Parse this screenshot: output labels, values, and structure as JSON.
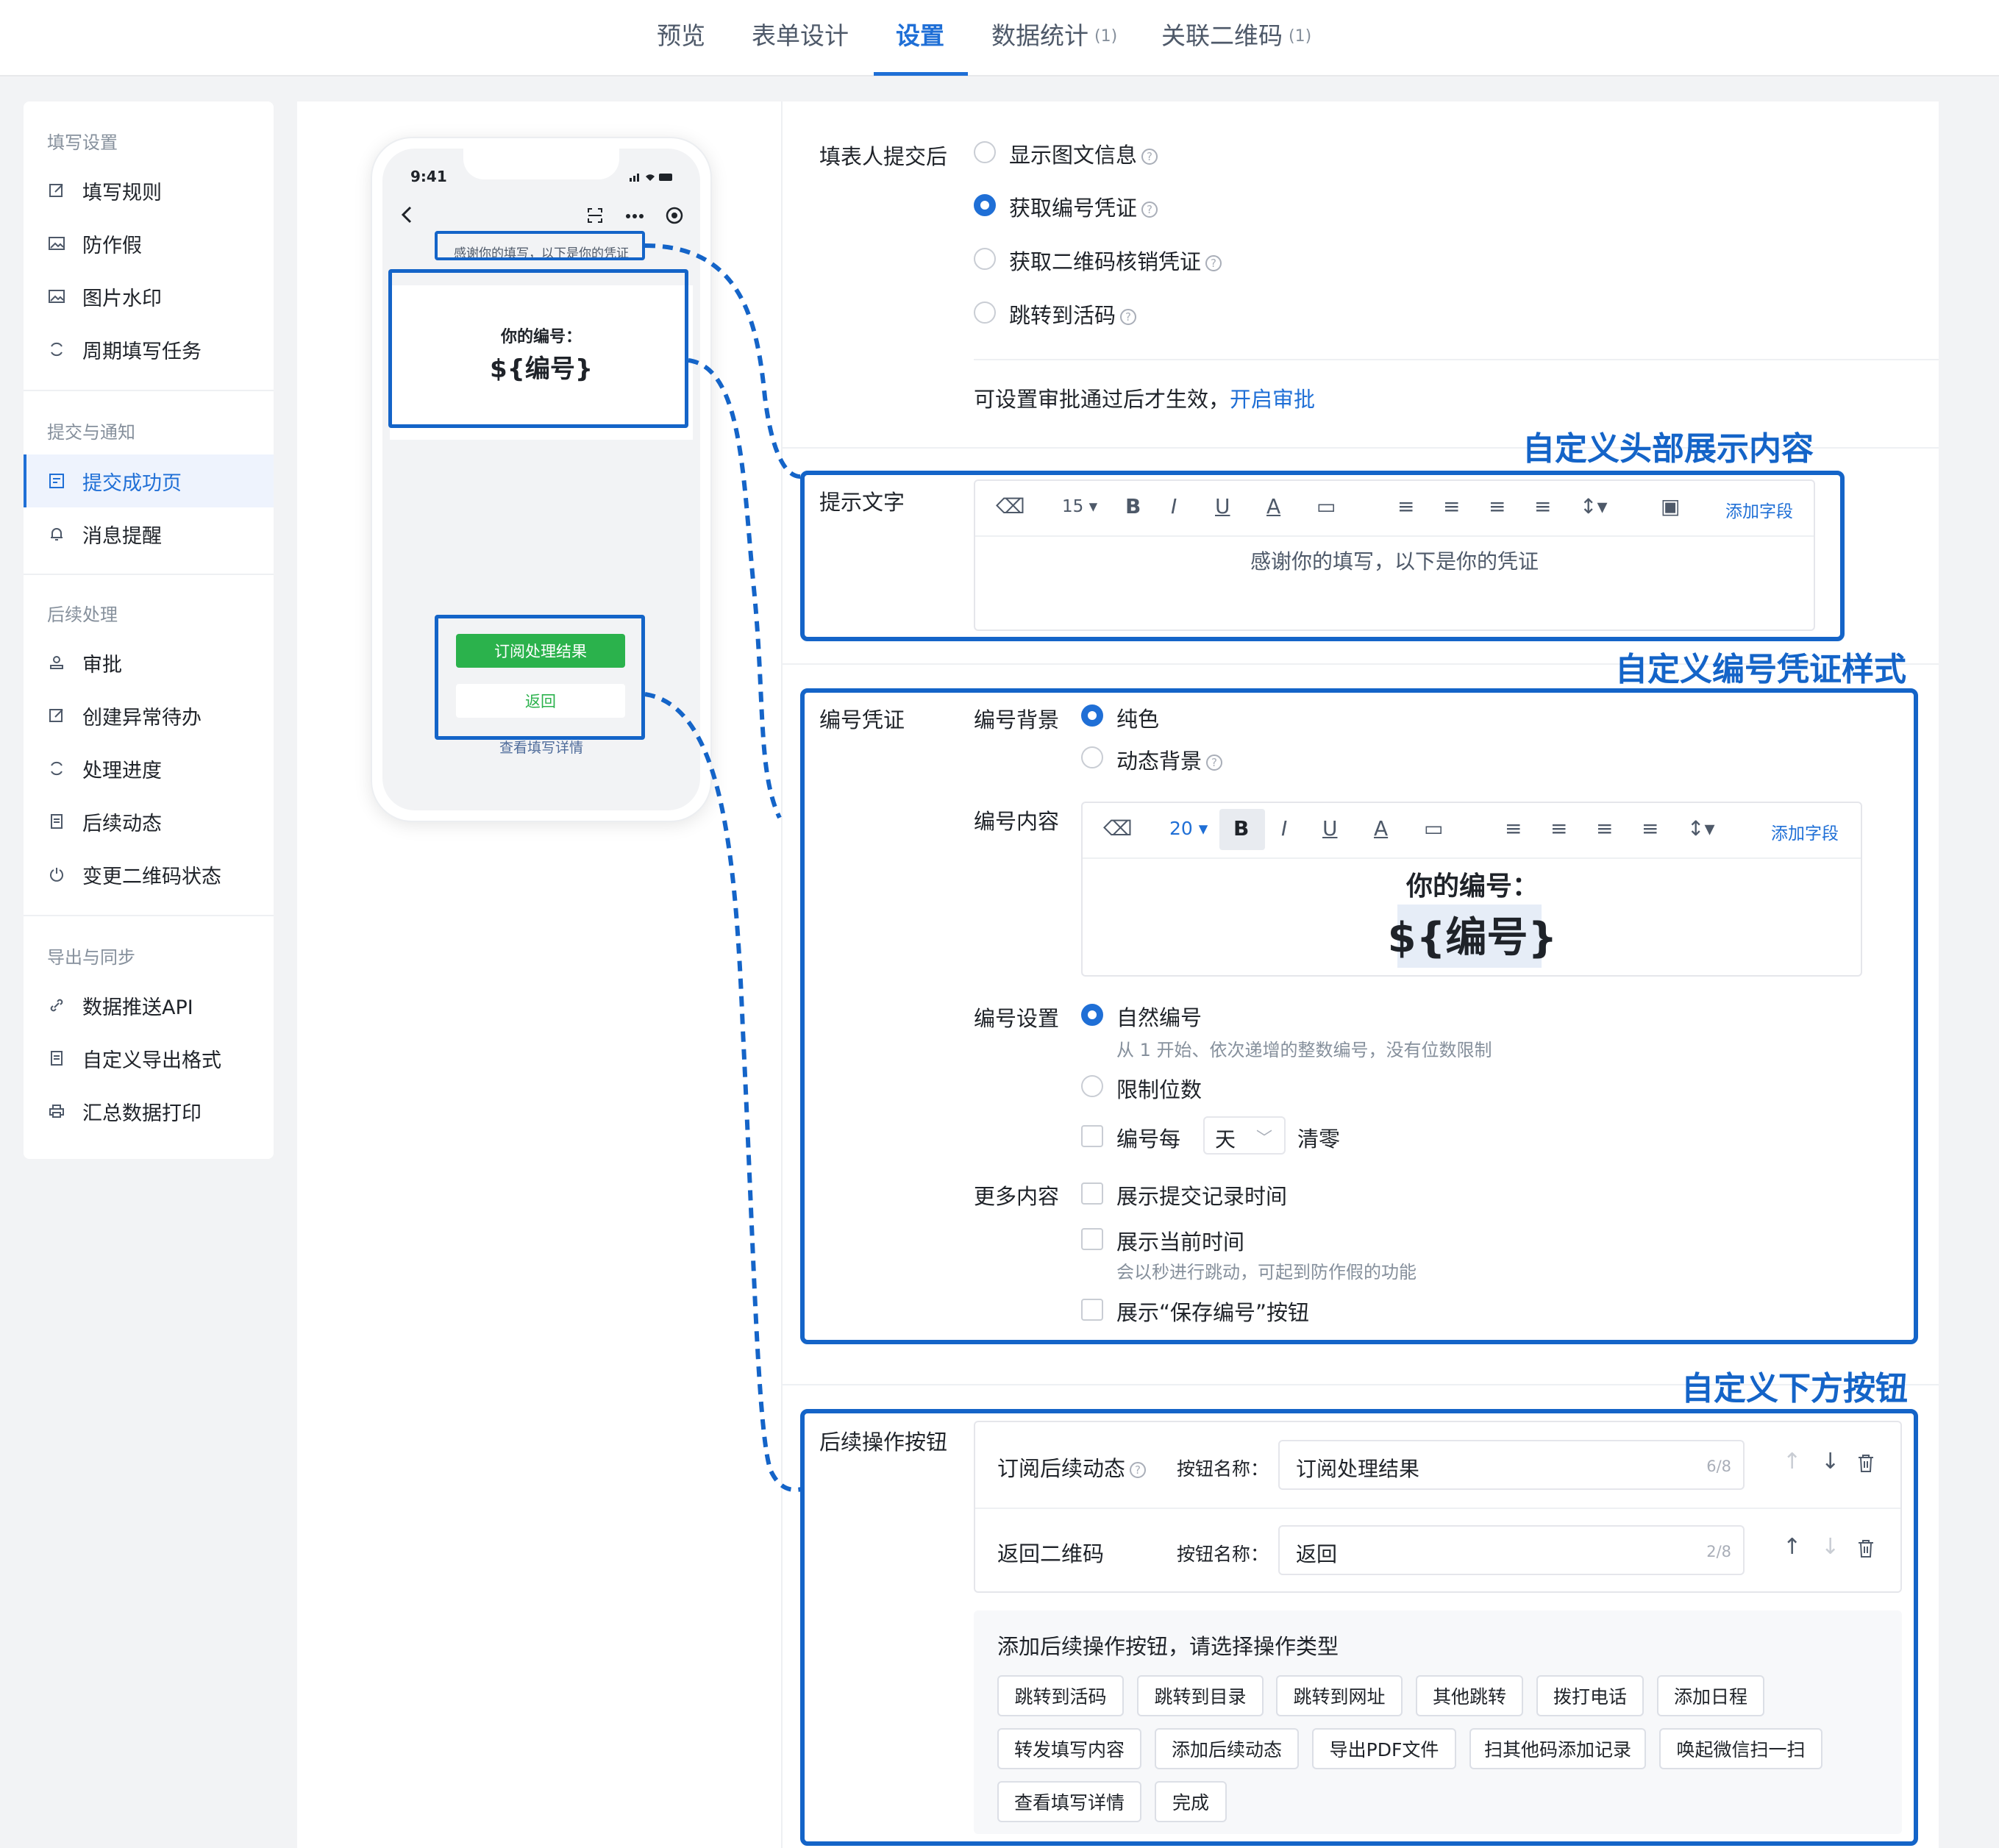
{
  "tabs": [
    {
      "label": "预览",
      "count": ""
    },
    {
      "label": "表单设计",
      "count": ""
    },
    {
      "label": "设置",
      "count": ""
    },
    {
      "label": "数据统计",
      "count": "(1)"
    },
    {
      "label": "关联二维码",
      "count": "(1)"
    }
  ],
  "sidebar": {
    "groups": [
      "填写设置",
      "提交与通知",
      "后续处理",
      "导出与同步"
    ],
    "items": [
      "填写规则",
      "防作假",
      "图片水印",
      "周期填写任务",
      "提交成功页",
      "消息提醒",
      "审批",
      "创建异常待办",
      "处理进度",
      "后续动态",
      "变更二维码状态",
      "数据推送API",
      "自定义导出格式",
      "汇总数据打印"
    ]
  },
  "phone": {
    "time": "9:41",
    "header_text": "感谢你的填写，以下是你的凭证",
    "card_label": "你的编号：",
    "card_value": "${编号}",
    "btn_primary": "订阅处理结果",
    "btn_secondary": "返回",
    "detail_link": "查看填写详情"
  },
  "after_submit": {
    "label": "填表人提交后",
    "options": [
      "显示图文信息",
      "获取编号凭证",
      "获取二维码核销凭证",
      "跳转到活码"
    ],
    "selected_index": 1,
    "approval_text": "可设置审批通过后才生效，",
    "approval_link": "开启审批"
  },
  "annotations": [
    "自定义头部展示内容",
    "自定义编号凭证样式",
    "自定义下方按钮"
  ],
  "prompt_text": {
    "label": "提示文字",
    "font_size": "15",
    "add_field": "添加字段",
    "content": "感谢你的填写，以下是你的凭证"
  },
  "voucher": {
    "label": "编号凭证",
    "bg_label": "编号背景",
    "bg_options": [
      "纯色",
      "动态背景"
    ],
    "content_label": "编号内容",
    "font_size": "20",
    "add_field": "添加字段",
    "content_line1": "你的编号：",
    "content_line2": "${编号}",
    "setting_label": "编号设置",
    "natural": "自然编号",
    "natural_hint": "从 1 开始、依次递增的整数编号，没有位数限制",
    "limit_digits": "限制位数",
    "reset_prefix": "编号每",
    "reset_unit": "天",
    "reset_suffix": "清零",
    "more_label": "更多内容",
    "more_1": "展示提交记录时间",
    "more_2": "展示当前时间",
    "more_2_hint": "会以秒进行跳动，可起到防作假的功能",
    "more_3": "展示“保存编号”按钮"
  },
  "followup": {
    "label": "后续操作按钮",
    "rows": [
      {
        "type": "订阅后续动态",
        "name_label": "按钮名称：",
        "value": "订阅处理结果",
        "count": "6/8"
      },
      {
        "type": "返回二维码",
        "name_label": "按钮名称：",
        "value": "返回",
        "count": "2/8"
      }
    ],
    "add_title": "添加后续操作按钮，请选择操作类型",
    "chips_row1": [
      "跳转到活码",
      "跳转到目录",
      "跳转到网址",
      "其他跳转",
      "拨打电话",
      "添加日程"
    ],
    "chips_row2": [
      "转发填写内容",
      "添加后续动态",
      "导出PDF文件",
      "扫其他码添加记录",
      "唤起微信扫一扫"
    ],
    "chips_row3": [
      "查看填写详情",
      "完成"
    ]
  },
  "colors": {
    "accent": "#1f6fd6",
    "annotation": "#1464c8",
    "green": "#2bb24c"
  }
}
